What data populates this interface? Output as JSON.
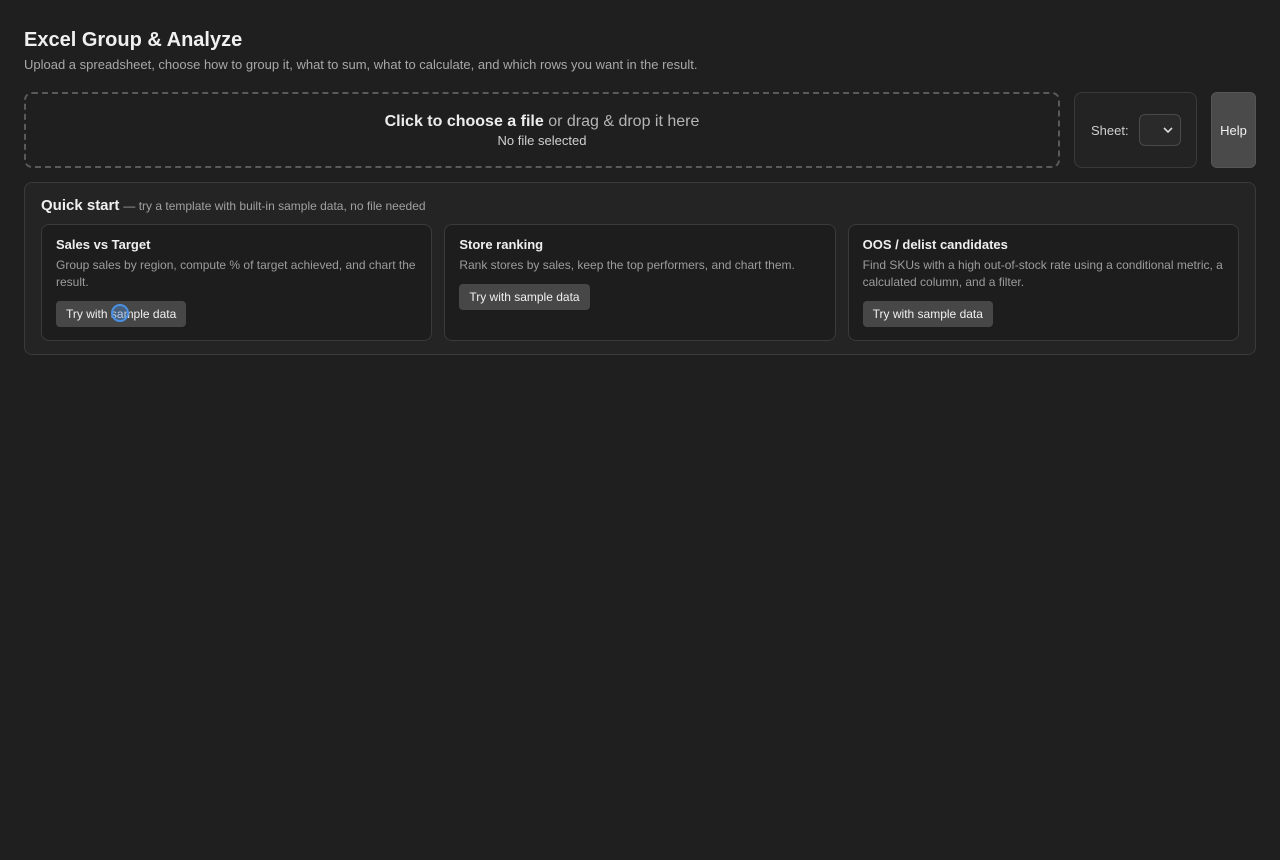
{
  "header": {
    "title": "Excel Group & Analyze",
    "subtitle": "Upload a spreadsheet, choose how to group it, what to sum, what to calculate, and which rows you want in the result."
  },
  "upload": {
    "choose_label": "Click to choose a file",
    "drag_label": " or drag & drop it here",
    "file_status": "No file selected"
  },
  "sheet": {
    "label": "Sheet:",
    "selected_value": ""
  },
  "help": {
    "label": "Help"
  },
  "quick_start": {
    "title": "Quick start",
    "subtitle": "— try a template with built-in sample data, no file needed",
    "cards": [
      {
        "title": "Sales vs Target",
        "description": "Group sales by region, compute % of target achieved, and chart the result.",
        "button_label": "Try with sample data"
      },
      {
        "title": "Store ranking",
        "description": "Rank stores by sales, keep the top performers, and chart them.",
        "button_label": "Try with sample data"
      },
      {
        "title": "OOS / delist candidates",
        "description": "Find SKUs with a high out-of-stock rate using a conditional metric, a calculated column, and a filter.",
        "button_label": "Try with sample data"
      }
    ]
  }
}
